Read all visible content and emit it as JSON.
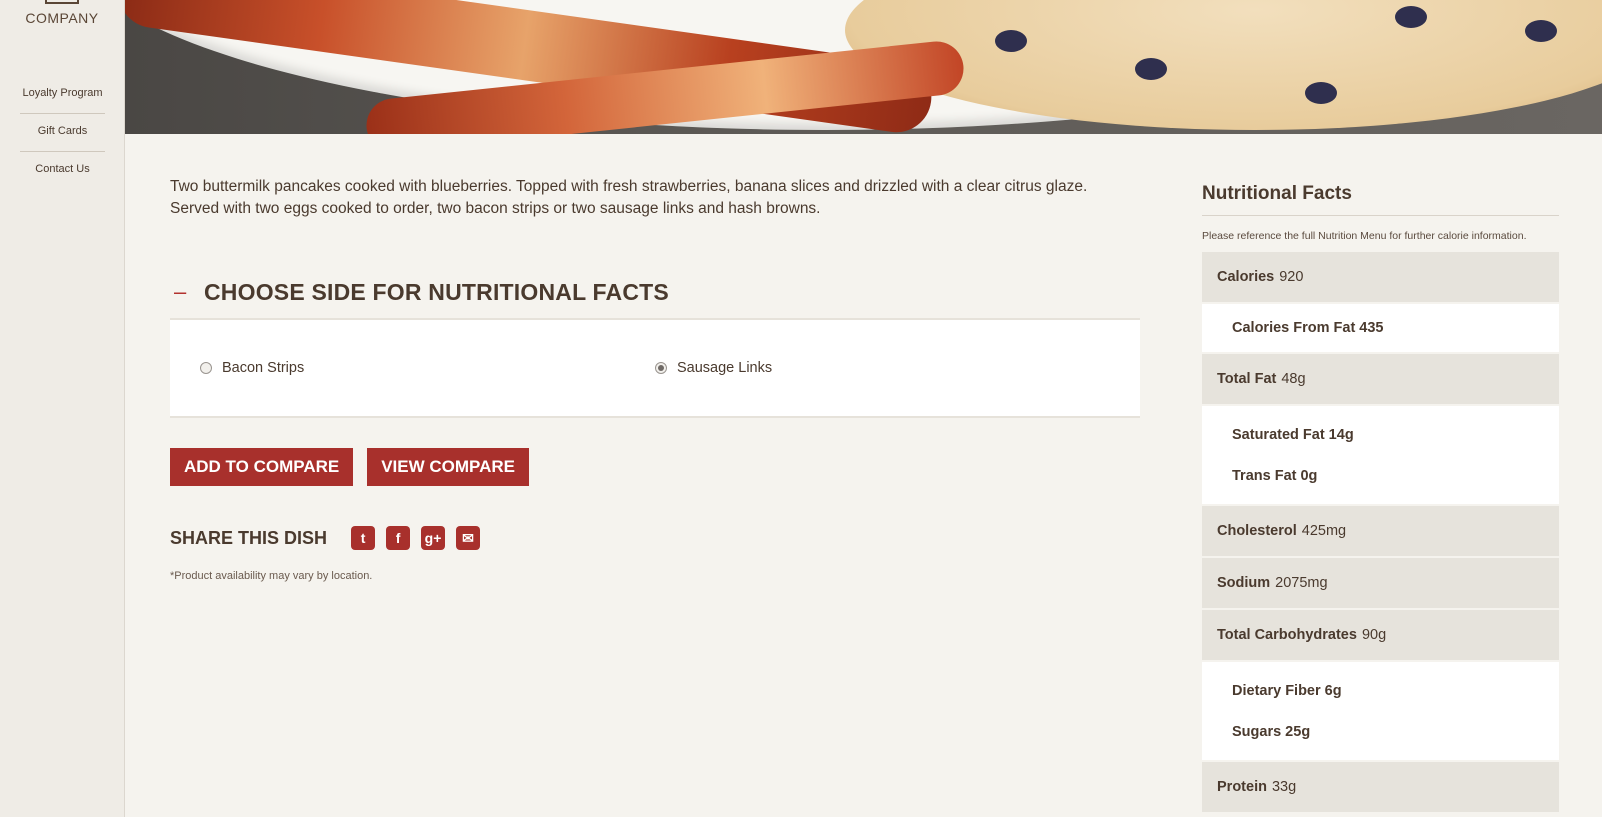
{
  "sidebar": {
    "logo_text": "COMPANY",
    "items": [
      {
        "label": "Loyalty Program"
      },
      {
        "label": "Gift Cards"
      },
      {
        "label": "Contact Us"
      }
    ]
  },
  "main": {
    "description": "Two buttermilk pancakes cooked with blueberries. Topped with fresh strawberries, banana slices and drizzled with a clear citrus glaze. Served with two eggs cooked to order, two bacon strips or two sausage links and hash browns.",
    "accordion": {
      "toggle": "–",
      "title": "CHOOSE SIDE FOR NUTRITIONAL FACTS",
      "options": [
        {
          "label": "Bacon Strips",
          "checked": false
        },
        {
          "label": "Sausage Links",
          "checked": true
        }
      ]
    },
    "buttons": {
      "add_compare": "ADD TO COMPARE",
      "view_compare": "VIEW COMPARE"
    },
    "share": {
      "title": "SHARE THIS DISH",
      "icons": [
        "twitter-icon",
        "facebook-icon",
        "google-plus-icon",
        "email-icon"
      ]
    },
    "footnote": "*Product availability may vary by location."
  },
  "nutrition": {
    "title": "Nutritional Facts",
    "note": "Please reference the full Nutrition Menu for further calorie information.",
    "calories": {
      "label": "Calories",
      "value": "920"
    },
    "calories_from_fat": "Calories From Fat 435",
    "total_fat": {
      "label": "Total Fat",
      "value": "48g"
    },
    "saturated_fat": "Saturated Fat 14g",
    "trans_fat": "Trans Fat 0g",
    "cholesterol": {
      "label": "Cholesterol",
      "value": "425mg"
    },
    "sodium": {
      "label": "Sodium",
      "value": "2075mg"
    },
    "total_carbs": {
      "label": "Total Carbohydrates",
      "value": "90g"
    },
    "dietary_fiber": "Dietary Fiber 6g",
    "sugars": "Sugars 25g",
    "protein": {
      "label": "Protein",
      "value": "33g"
    }
  },
  "colors": {
    "accent": "#a8302c",
    "text": "#4a3a2e",
    "background": "#f5f3ee"
  }
}
